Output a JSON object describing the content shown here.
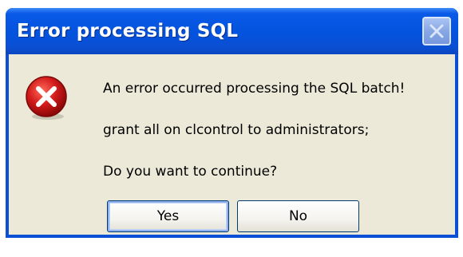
{
  "dialog": {
    "title": "Error processing SQL",
    "close_icon": "close-icon",
    "error_icon": "error-icon",
    "message_line1": "An error occurred processing the SQL batch!",
    "message_line2": "grant all on clcontrol to administrators;",
    "message_line3": "Do you want to continue?",
    "buttons": {
      "yes_label": "Yes",
      "no_label": "No"
    },
    "colors": {
      "titlebar": "#0453de",
      "client": "#ece9d8",
      "icon_red": "#d21a1a"
    }
  }
}
